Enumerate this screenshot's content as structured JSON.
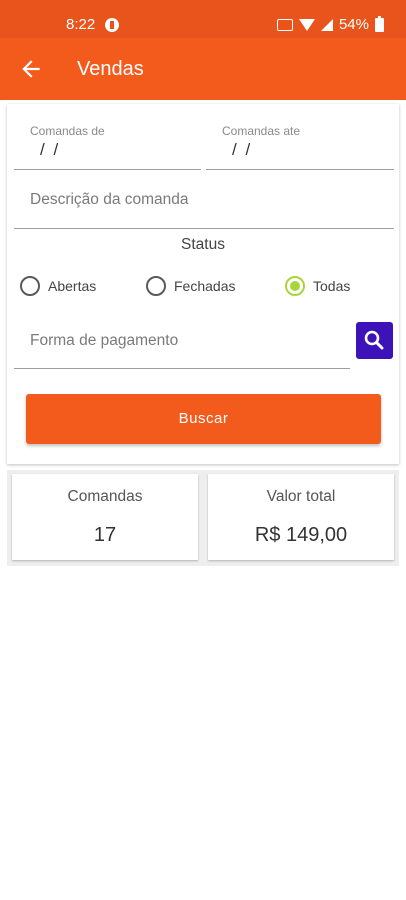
{
  "status_bar": {
    "time": "8:22",
    "battery": "54%"
  },
  "app_bar": {
    "title": "Vendas"
  },
  "form": {
    "comandas_de_label": "Comandas de",
    "comandas_de_value": "/ /",
    "comandas_ate_label": "Comandas ate",
    "comandas_ate_value": "/ /",
    "descricao_placeholder": "Descrição da comanda",
    "status_title": "Status",
    "status_options": [
      "Abertas",
      "Fechadas",
      "Todas"
    ],
    "status_selected": "Todas",
    "forma_pagamento_placeholder": "Forma de pagamento",
    "buscar_label": "Buscar"
  },
  "summary": {
    "comandas_label": "Comandas",
    "comandas_value": "17",
    "valor_total_label": "Valor total",
    "valor_total_value": "R$ 149,00"
  },
  "colors": {
    "accent": "#f35b1d",
    "status_bar": "#e8541c",
    "search_button": "#3d12b8",
    "radio_selected": "#a7d63a"
  },
  "icons": [
    "back-arrow-icon",
    "search-icon",
    "wifi-icon",
    "signal-icon",
    "battery-icon",
    "data-icon"
  ]
}
